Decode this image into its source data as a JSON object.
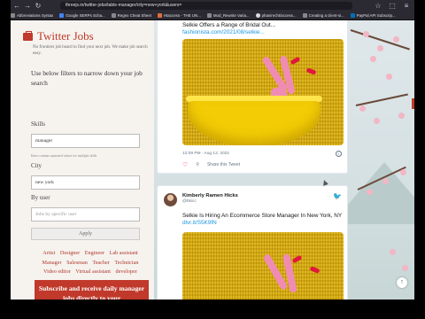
{
  "browser": {
    "url": "threejs.in/twitter-jobs/table-manager/city=new+york&users=",
    "bookmarks": [
      {
        "label": "Abbreviations Syntax",
        "color": "#cccccc"
      },
      {
        "label": "Google SERPs Scha...",
        "color": "#4285f4"
      },
      {
        "label": "Regex Cheat Sheet",
        "color": "#999999"
      },
      {
        "label": "Htaccess - THE UN...",
        "color": "#e06c3c"
      },
      {
        "label": "Mod_Rewrite Varia...",
        "color": "#999999"
      },
      {
        "label": "phanirecht/access...",
        "color": "#dddddd"
      },
      {
        "label": "Creating a client-si...",
        "color": "#999999"
      },
      {
        "label": "PayPal API Subscrip...",
        "color": "#0070ba"
      }
    ]
  },
  "sidebar": {
    "logo": "Twitter Jobs",
    "tagline": "No frontiers job board to find your next job. We make job search easy.",
    "filter_title": "Use below filters to narrow down your job search",
    "skills_label": "Skills",
    "skills_value": "manager",
    "skills_hint": "Enter comma separated values for multiple skills",
    "city_label": "City",
    "city_value": "new york",
    "user_label": "By user",
    "user_placeholder": "Jobs by specific user",
    "apply_label": "Apply",
    "tags": [
      "Artist",
      "Designer",
      "Engineer",
      "Lab assistant",
      "Manager",
      "Salesman",
      "Teacher",
      "Technician",
      "Video editor",
      "Virtual assistant",
      "developer"
    ],
    "cta": "Subscribe and receive daily manager jobs directly to your"
  },
  "feed": {
    "tweet1": {
      "text_line": "Selkie Offers a Range of Bridal Out...",
      "link": "fashionista.com/2021/08/selkie...",
      "time": "12:09 PM · Aug 12, 2021",
      "likes": "",
      "share": "Share this Tweet"
    },
    "tweet2": {
      "author": "Kimberly Ramen Hicks",
      "handle": "@hkicc",
      "text": "Selkie Is Hiring An Ecommerce Store Manager In New York, NY",
      "link": "dlvr.it/S5K9fN"
    }
  }
}
